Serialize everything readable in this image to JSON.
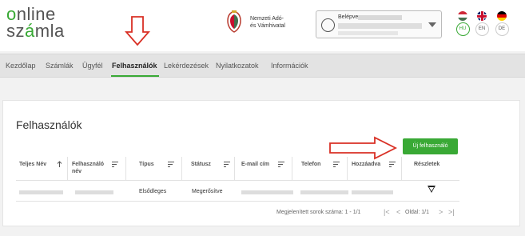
{
  "header": {
    "logo_line1": "online",
    "logo_line2": "számla",
    "authority_line1": "Nemzeti Adó-",
    "authority_line2": "és Vámhivatal",
    "user_label": "Belépve: ",
    "languages": [
      "HU",
      "EN",
      "DE"
    ],
    "active_language": "HU"
  },
  "nav": {
    "items": [
      "Kezdőlap",
      "Számlák",
      "Ügyfél",
      "Felhasználók",
      "Lekérdezések",
      "Nyilatkozatok",
      "Információk"
    ],
    "active": "Felhasználók"
  },
  "main": {
    "title": "Felhasználók",
    "new_user_button": "Új felhasználó",
    "columns": [
      {
        "label_line1": "Teljes Név",
        "label_line2": ""
      },
      {
        "label_line1": "Felhasználó",
        "label_line2": "név"
      },
      {
        "label_line1": "Típus",
        "label_line2": ""
      },
      {
        "label_line1": "Státusz",
        "label_line2": ""
      },
      {
        "label_line1": "E-mail cím",
        "label_line2": ""
      },
      {
        "label_line1": "Telefon",
        "label_line2": ""
      },
      {
        "label_line1": "Hozzáadva",
        "label_line2": ""
      },
      {
        "label_line1": "Részletek",
        "label_line2": ""
      }
    ],
    "rows": [
      {
        "type": "Elsődleges",
        "status": "Megerősítve"
      }
    ],
    "pagination": {
      "summary": "Megjelenített sorok száma: 1 - 1/1",
      "page": "Oldal: 1/1"
    }
  },
  "colors": {
    "accent": "#39a935",
    "annotation": "#d93025"
  }
}
